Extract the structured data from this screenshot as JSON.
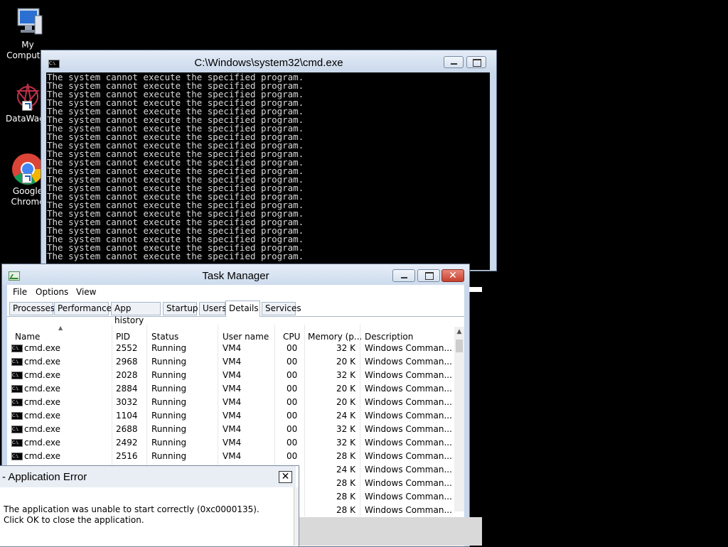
{
  "desktop": {
    "icons": [
      {
        "label": "My Computer"
      },
      {
        "label": "DataWago"
      },
      {
        "label": "Google Chrome"
      }
    ]
  },
  "cmd": {
    "title": "C:\\Windows\\system32\\cmd.exe",
    "icon_text": "C:\\.",
    "line": "The system cannot execute the specified program.",
    "line_count": 22
  },
  "taskmanager": {
    "title": "Task Manager",
    "menu": {
      "file": "File",
      "options": "Options",
      "view": "View"
    },
    "tabs": {
      "processes": "Processes",
      "performance": "Performance",
      "apphistory": "App history",
      "startup": "Startup",
      "users": "Users",
      "details": "Details",
      "services": "Services"
    },
    "active_tab": "Details",
    "columns": {
      "name": "Name",
      "pid": "PID",
      "status": "Status",
      "user": "User name",
      "cpu": "CPU",
      "memory": "Memory (p...",
      "description": "Description"
    },
    "rows": [
      {
        "name": "cmd.exe",
        "pid": "2552",
        "status": "Running",
        "user": "VM4",
        "cpu": "00",
        "memory": "32 K",
        "description": "Windows Comman..."
      },
      {
        "name": "cmd.exe",
        "pid": "2968",
        "status": "Running",
        "user": "VM4",
        "cpu": "00",
        "memory": "20 K",
        "description": "Windows Comman..."
      },
      {
        "name": "cmd.exe",
        "pid": "2028",
        "status": "Running",
        "user": "VM4",
        "cpu": "00",
        "memory": "32 K",
        "description": "Windows Comman..."
      },
      {
        "name": "cmd.exe",
        "pid": "2884",
        "status": "Running",
        "user": "VM4",
        "cpu": "00",
        "memory": "20 K",
        "description": "Windows Comman..."
      },
      {
        "name": "cmd.exe",
        "pid": "3032",
        "status": "Running",
        "user": "VM4",
        "cpu": "00",
        "memory": "20 K",
        "description": "Windows Comman..."
      },
      {
        "name": "cmd.exe",
        "pid": "1104",
        "status": "Running",
        "user": "VM4",
        "cpu": "00",
        "memory": "24 K",
        "description": "Windows Comman..."
      },
      {
        "name": "cmd.exe",
        "pid": "2688",
        "status": "Running",
        "user": "VM4",
        "cpu": "00",
        "memory": "32 K",
        "description": "Windows Comman..."
      },
      {
        "name": "cmd.exe",
        "pid": "2492",
        "status": "Running",
        "user": "VM4",
        "cpu": "00",
        "memory": "32 K",
        "description": "Windows Comman..."
      },
      {
        "name": "cmd.exe",
        "pid": "2516",
        "status": "Running",
        "user": "VM4",
        "cpu": "00",
        "memory": "28 K",
        "description": "Windows Comman..."
      },
      {
        "name": "",
        "pid": "",
        "status": "",
        "user": "",
        "cpu": "",
        "memory": "24 K",
        "description": "Windows Comman..."
      },
      {
        "name": "",
        "pid": "",
        "status": "",
        "user": "",
        "cpu": "",
        "memory": "28 K",
        "description": "Windows Comman..."
      },
      {
        "name": "",
        "pid": "",
        "status": "",
        "user": "",
        "cpu": "",
        "memory": "28 K",
        "description": "Windows Comman..."
      },
      {
        "name": "",
        "pid": "",
        "status": "",
        "user": "",
        "cpu": "",
        "memory": "28 K",
        "description": "Windows Comman..."
      }
    ]
  },
  "error_dialog": {
    "title": "- Application Error",
    "close": "✕",
    "message": "The application was unable to start correctly (0xc0000135). Click OK to close the application."
  }
}
